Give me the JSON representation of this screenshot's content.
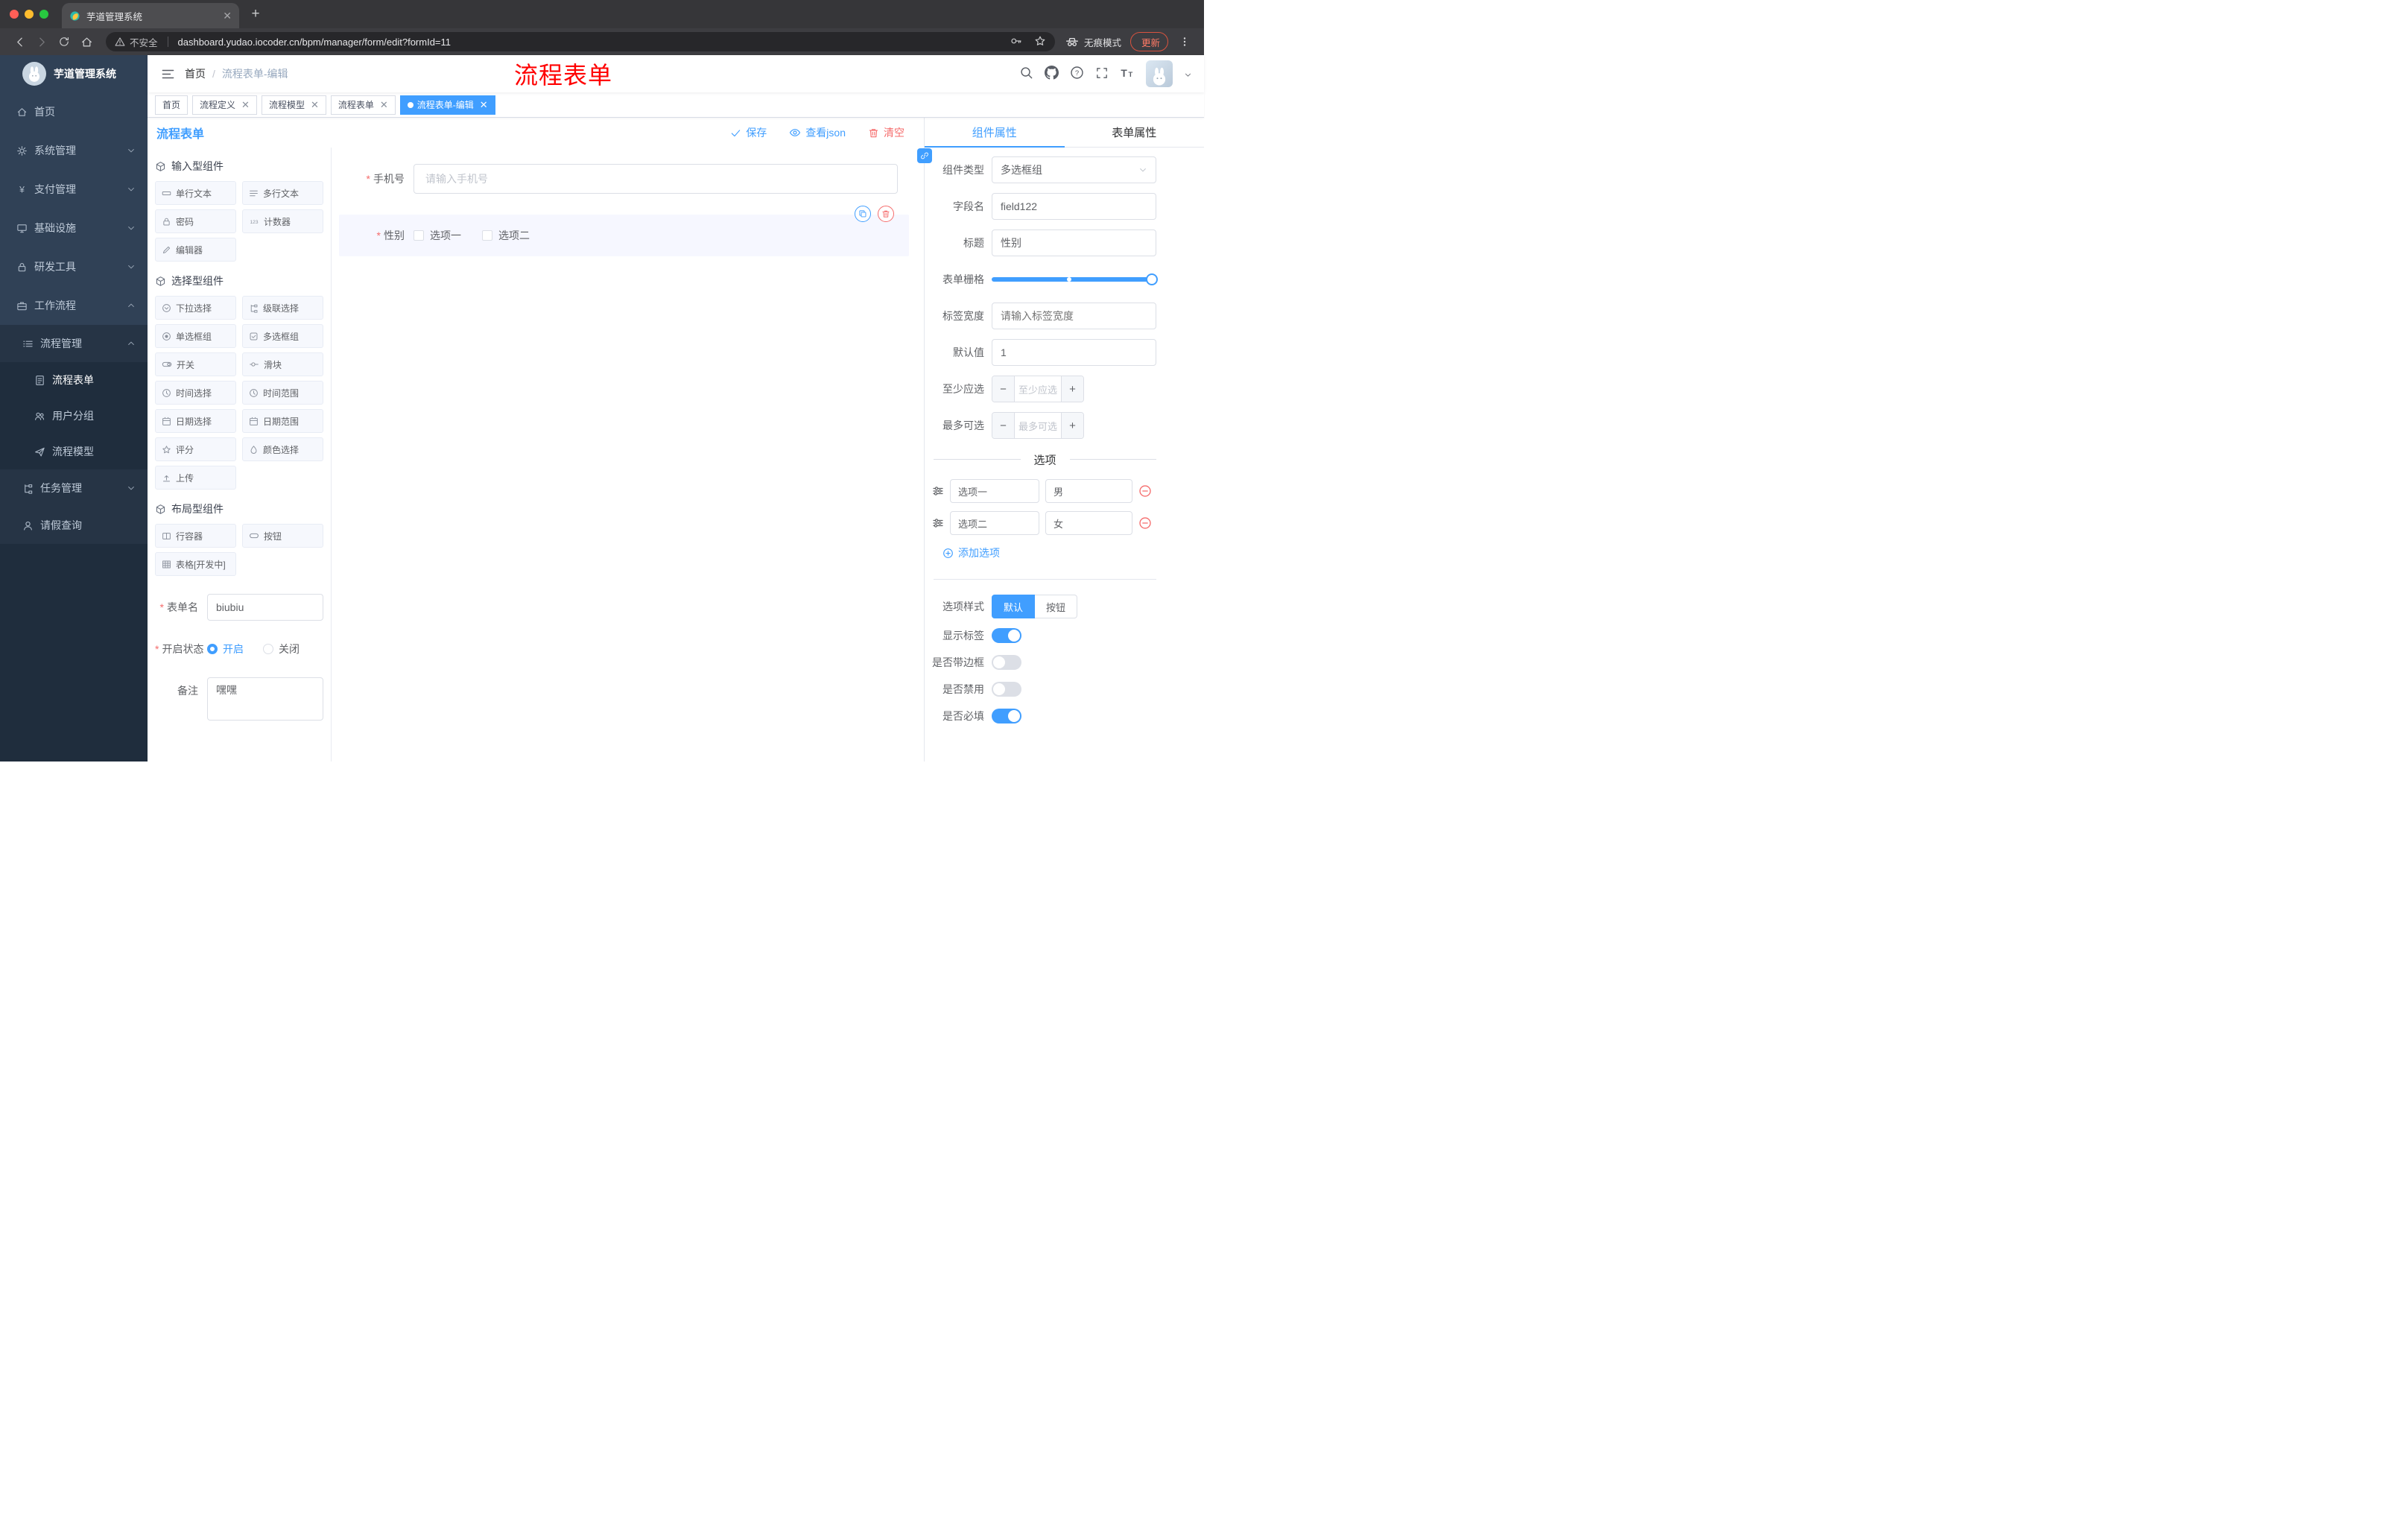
{
  "browser": {
    "tab_title": "芋道管理系统",
    "url_warning": "不安全",
    "url": "dashboard.yudao.iocoder.cn/bpm/manager/form/edit?formId=11",
    "incognito_label": "无痕模式",
    "update_label": "更新"
  },
  "sidebar": {
    "title": "芋道管理系统",
    "items": [
      {
        "label": "首页"
      },
      {
        "label": "系统管理"
      },
      {
        "label": "支付管理"
      },
      {
        "label": "基础设施"
      },
      {
        "label": "研发工具"
      },
      {
        "label": "工作流程"
      },
      {
        "label": "流程管理"
      },
      {
        "label": "流程表单"
      },
      {
        "label": "用户分组"
      },
      {
        "label": "流程模型"
      },
      {
        "label": "任务管理"
      },
      {
        "label": "请假查询"
      }
    ]
  },
  "navbar": {
    "breadcrumb_home": "首页",
    "breadcrumb_sep": "/",
    "breadcrumb_current": "流程表单-编辑",
    "watermark": "流程表单"
  },
  "tags": [
    {
      "label": "首页"
    },
    {
      "label": "流程定义"
    },
    {
      "label": "流程模型"
    },
    {
      "label": "流程表单"
    },
    {
      "label": "流程表单-编辑"
    }
  ],
  "designer": {
    "title": "流程表单",
    "actions": {
      "save": "保存",
      "view_json": "查看json",
      "clear": "清空"
    },
    "palette": {
      "groups": [
        {
          "title": "输入型组件",
          "items": [
            {
              "label": "单行文本",
              "icon": "single-line-text-icon"
            },
            {
              "label": "多行文本",
              "icon": "multi-line-text-icon"
            },
            {
              "label": "密码",
              "icon": "password-icon"
            },
            {
              "label": "计数器",
              "icon": "counter-icon"
            },
            {
              "label": "编辑器",
              "icon": "editor-icon"
            }
          ]
        },
        {
          "title": "选择型组件",
          "items": [
            {
              "label": "下拉选择",
              "icon": "select-icon"
            },
            {
              "label": "级联选择",
              "icon": "cascader-icon"
            },
            {
              "label": "单选框组",
              "icon": "radio-group-icon"
            },
            {
              "label": "多选框组",
              "icon": "checkbox-group-icon"
            },
            {
              "label": "开关",
              "icon": "switch-icon"
            },
            {
              "label": "滑块",
              "icon": "slider-icon"
            },
            {
              "label": "时间选择",
              "icon": "time-picker-icon"
            },
            {
              "label": "时间范围",
              "icon": "time-range-icon"
            },
            {
              "label": "日期选择",
              "icon": "date-picker-icon"
            },
            {
              "label": "日期范围",
              "icon": "date-range-icon"
            },
            {
              "label": "评分",
              "icon": "rate-icon"
            },
            {
              "label": "颜色选择",
              "icon": "color-picker-icon"
            },
            {
              "label": "上传",
              "icon": "upload-icon"
            }
          ]
        },
        {
          "title": "布局型组件",
          "items": [
            {
              "label": "行容器",
              "icon": "row-container-icon"
            },
            {
              "label": "按钮",
              "icon": "button-icon"
            },
            {
              "label": "表格[开发中]",
              "icon": "table-icon"
            }
          ]
        }
      ],
      "form": {
        "name_label": "表单名",
        "name_value": "biubiu",
        "status_label": "开启状态",
        "status_on": "开启",
        "status_off": "关闭",
        "remark_label": "备注",
        "remark_value": "嘿嘿"
      }
    },
    "canvas": {
      "phone": {
        "label": "手机号",
        "placeholder": "请输入手机号"
      },
      "gender": {
        "label": "性别",
        "options": [
          {
            "label": "选项一"
          },
          {
            "label": "选项二"
          }
        ]
      }
    },
    "props": {
      "tab_component": "组件属性",
      "tab_form": "表单属性",
      "component_type_label": "组件类型",
      "component_type_value": "多选框组",
      "field_name_label": "字段名",
      "field_name_value": "field122",
      "title_label": "标题",
      "title_value": "性别",
      "grid_label": "表单栅格",
      "label_width_label": "标签宽度",
      "label_width_placeholder": "请输入标签宽度",
      "default_label": "默认值",
      "default_value": "1",
      "min_label": "至少应选",
      "min_placeholder": "至少应选",
      "max_label": "最多可选",
      "max_placeholder": "最多可选",
      "options_divider": "选项",
      "options": [
        {
          "label": "选项一",
          "value": "男"
        },
        {
          "label": "选项二",
          "value": "女"
        }
      ],
      "add_option": "添加选项",
      "option_style_label": "选项样式",
      "option_style_default": "默认",
      "option_style_button": "按钮",
      "show_label_label": "显示标签",
      "border_label": "是否带边框",
      "disabled_label": "是否禁用",
      "required_label": "是否必填"
    }
  },
  "colors": {
    "accent": "#409eff",
    "danger": "#f56c6c",
    "watermark_red": "#ff0000"
  }
}
